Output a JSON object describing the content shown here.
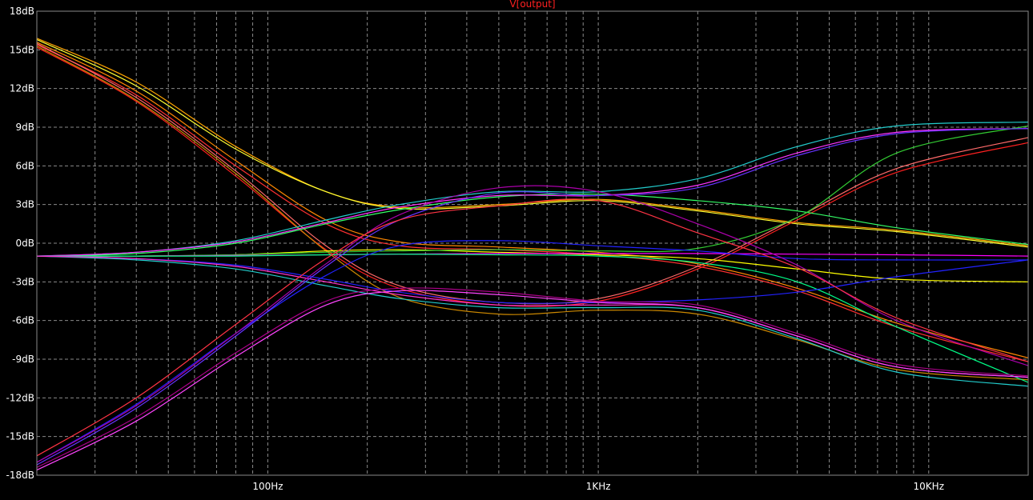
{
  "chart_data": {
    "type": "line",
    "title": "V[output]",
    "xscale": "log",
    "xlim": [
      20,
      20000
    ],
    "ylim": [
      -18,
      18
    ],
    "grid": true,
    "x_ticks": [
      100,
      1000,
      10000
    ],
    "x_tick_labels": [
      "100Hz",
      "1KHz",
      "10KHz"
    ],
    "y_ticks": [
      18,
      15,
      12,
      9,
      6,
      3,
      0,
      -3,
      -6,
      -9,
      -12,
      -15,
      -18
    ],
    "y_tick_labels": [
      "18dB",
      "15dB",
      "12dB",
      "9dB",
      "6dB",
      "3dB",
      "0dB",
      "-3dB",
      "-6dB",
      "-9dB",
      "-12dB",
      "-15dB",
      "-18dB"
    ],
    "colors": {
      "background": "#000000",
      "grid": "#8a8a8a",
      "axis_text": "#ffffff",
      "title": "#ff2020"
    },
    "series": [
      {
        "color": "#ffa500",
        "x": [
          20,
          40,
          80,
          150,
          250,
          500,
          1000,
          2000,
          4000,
          8000,
          20000
        ],
        "y": [
          15.9,
          12.5,
          7.5,
          4.0,
          2.8,
          3.0,
          3.4,
          2.6,
          1.6,
          1.0,
          -0.2
        ]
      },
      {
        "color": "#ffff33",
        "x": [
          20,
          40,
          80,
          150,
          250,
          500,
          1000,
          2000,
          4000,
          8000,
          20000
        ],
        "y": [
          15.8,
          12.2,
          7.3,
          4.0,
          2.7,
          2.9,
          3.3,
          2.5,
          1.5,
          0.9,
          -0.3
        ]
      },
      {
        "color": "#ff3030",
        "x": [
          20,
          40,
          80,
          150,
          250,
          500,
          1000,
          2000,
          4000,
          8000,
          20000
        ],
        "y": [
          15.4,
          11.5,
          6.0,
          1.5,
          -0.2,
          -0.5,
          -0.9,
          -1.8,
          -3.7,
          -6.5,
          -9.2
        ]
      },
      {
        "color": "#ff8800",
        "x": [
          20,
          40,
          80,
          150,
          250,
          500,
          1000,
          2000,
          4000,
          8000,
          20000
        ],
        "y": [
          15.6,
          11.8,
          6.4,
          1.8,
          0.1,
          -0.3,
          -0.7,
          -1.6,
          -3.5,
          -6.2,
          -8.9
        ]
      },
      {
        "color": "#ff2020",
        "x": [
          20,
          40,
          80,
          150,
          250,
          500,
          1000,
          2000,
          4000,
          8000,
          20000
        ],
        "y": [
          15.2,
          11.0,
          5.2,
          -0.5,
          -3.5,
          -4.8,
          -4.5,
          -2.0,
          1.8,
          5.5,
          7.8
        ]
      },
      {
        "color": "#ff6a6a",
        "x": [
          20,
          40,
          80,
          150,
          250,
          500,
          1000,
          2000,
          4000,
          8000,
          20000
        ],
        "y": [
          15.5,
          11.3,
          5.6,
          -0.2,
          -3.3,
          -4.6,
          -4.3,
          -1.8,
          2.0,
          5.8,
          8.2
        ]
      },
      {
        "color": "#cc8800",
        "x": [
          20,
          40,
          80,
          150,
          250,
          500,
          1000,
          2000,
          4000,
          8000,
          20000
        ],
        "y": [
          15.3,
          11.1,
          5.4,
          -0.6,
          -4.2,
          -5.5,
          -5.2,
          -5.5,
          -7.5,
          -9.8,
          -10.6
        ]
      },
      {
        "color": "#ffff00",
        "x": [
          20,
          40,
          80,
          150,
          250,
          500,
          1000,
          2000,
          4000,
          8000,
          20000
        ],
        "y": [
          -1.0,
          -1.0,
          -0.9,
          -0.6,
          -0.5,
          -0.7,
          -0.9,
          -1.2,
          -2.0,
          -2.8,
          -3.0
        ]
      },
      {
        "color": "#33ff66",
        "x": [
          20,
          40,
          80,
          150,
          250,
          500,
          1000,
          2000,
          4000,
          8000,
          20000
        ],
        "y": [
          -1.0,
          -0.8,
          0.0,
          1.5,
          2.6,
          3.6,
          3.8,
          3.3,
          2.5,
          1.2,
          -0.1
        ]
      },
      {
        "color": "#22cccc",
        "x": [
          20,
          40,
          80,
          150,
          250,
          500,
          1000,
          2000,
          4000,
          8000,
          20000
        ],
        "y": [
          -1.0,
          -0.7,
          0.2,
          1.8,
          3.0,
          4.0,
          4.0,
          5.0,
          7.5,
          9.1,
          9.4
        ]
      },
      {
        "color": "#ff33ff",
        "x": [
          20,
          40,
          80,
          150,
          250,
          500,
          1000,
          2000,
          4000,
          8000,
          20000
        ],
        "y": [
          -1.0,
          -0.7,
          0.1,
          1.6,
          2.8,
          3.7,
          3.7,
          4.5,
          7.0,
          8.6,
          8.9
        ]
      },
      {
        "color": "#33cc33",
        "x": [
          20,
          40,
          80,
          150,
          250,
          500,
          1000,
          2000,
          4000,
          8000,
          20000
        ],
        "y": [
          -1.0,
          -1.0,
          -0.9,
          -0.7,
          -0.6,
          -0.5,
          -0.6,
          -0.4,
          2.0,
          7.0,
          9.1
        ]
      },
      {
        "color": "#ff00ff",
        "x": [
          20,
          40,
          80,
          150,
          250,
          500,
          1000,
          2000,
          4000,
          8000,
          20000
        ],
        "y": [
          -1.0,
          -1.0,
          -0.95,
          -0.9,
          -0.85,
          -0.8,
          -0.8,
          -0.8,
          -0.85,
          -0.9,
          -1.0
        ]
      },
      {
        "color": "#00ff88",
        "x": [
          20,
          40,
          80,
          150,
          250,
          500,
          1000,
          2000,
          4000,
          8000,
          20000
        ],
        "y": [
          -1.0,
          -1.0,
          -1.0,
          -0.9,
          -0.85,
          -0.9,
          -1.0,
          -1.5,
          -3.0,
          -6.5,
          -10.8
        ]
      },
      {
        "color": "#2222ff",
        "x": [
          20,
          40,
          80,
          150,
          250,
          500,
          1000,
          2000,
          4000,
          8000,
          20000
        ],
        "y": [
          -1.0,
          -1.2,
          -1.7,
          -2.8,
          -3.8,
          -4.6,
          -4.6,
          -4.4,
          -3.8,
          -2.6,
          -1.3
        ]
      },
      {
        "color": "#22cccc",
        "x": [
          20,
          40,
          80,
          150,
          250,
          500,
          1000,
          2000,
          4000,
          8000,
          20000
        ],
        "y": [
          -1.0,
          -1.3,
          -2.0,
          -3.3,
          -4.3,
          -5.0,
          -5.0,
          -5.2,
          -7.4,
          -10.0,
          -11.1
        ]
      },
      {
        "color": "#ff33cc",
        "x": [
          20,
          40,
          80,
          150,
          250,
          500,
          1000,
          2000,
          4000,
          8000,
          20000
        ],
        "y": [
          -1.0,
          -1.2,
          -1.8,
          -3.0,
          -4.0,
          -4.8,
          -4.8,
          -5.0,
          -7.2,
          -9.6,
          -10.4
        ]
      },
      {
        "color": "#2222ff",
        "x": [
          20,
          40,
          80,
          150,
          250,
          500,
          1000,
          2000,
          4000,
          8000,
          20000
        ],
        "y": [
          -17.0,
          -12.5,
          -7.0,
          -2.5,
          -0.2,
          0.2,
          -0.2,
          -0.6,
          -1.2,
          -1.3,
          -1.3
        ]
      },
      {
        "color": "#6633ff",
        "x": [
          20,
          40,
          80,
          150,
          250,
          500,
          1000,
          2000,
          4000,
          8000,
          20000
        ],
        "y": [
          -17.2,
          -12.8,
          -7.2,
          -1.8,
          1.8,
          3.9,
          3.7,
          4.3,
          6.8,
          8.5,
          8.9
        ]
      },
      {
        "color": "#aa00aa",
        "x": [
          20,
          40,
          80,
          150,
          250,
          500,
          1000,
          2000,
          4000,
          8000,
          20000
        ],
        "y": [
          -17.0,
          -12.6,
          -7.0,
          -1.6,
          2.2,
          4.3,
          4.0,
          1.5,
          -1.7,
          -6.0,
          -9.5
        ]
      },
      {
        "color": "#ff3344",
        "x": [
          20,
          40,
          80,
          150,
          250,
          500,
          1000,
          2000,
          4000,
          8000,
          20000
        ],
        "y": [
          -16.5,
          -12.0,
          -6.3,
          -1.2,
          1.8,
          2.9,
          3.3,
          0.8,
          -1.9,
          -5.8,
          -9.2
        ]
      },
      {
        "color": "#ff44ff",
        "x": [
          20,
          40,
          80,
          150,
          250,
          500,
          1000,
          2000,
          4000,
          8000,
          20000
        ],
        "y": [
          -17.6,
          -13.8,
          -8.8,
          -4.8,
          -3.7,
          -4.0,
          -4.6,
          -5.0,
          -7.2,
          -9.6,
          -10.4
        ]
      },
      {
        "color": "#aa0088",
        "x": [
          20,
          40,
          80,
          150,
          250,
          500,
          1000,
          2000,
          4000,
          8000,
          20000
        ],
        "y": [
          -17.4,
          -13.5,
          -8.5,
          -4.5,
          -3.5,
          -3.8,
          -4.5,
          -4.8,
          -7.0,
          -9.4,
          -10.3
        ]
      }
    ]
  }
}
